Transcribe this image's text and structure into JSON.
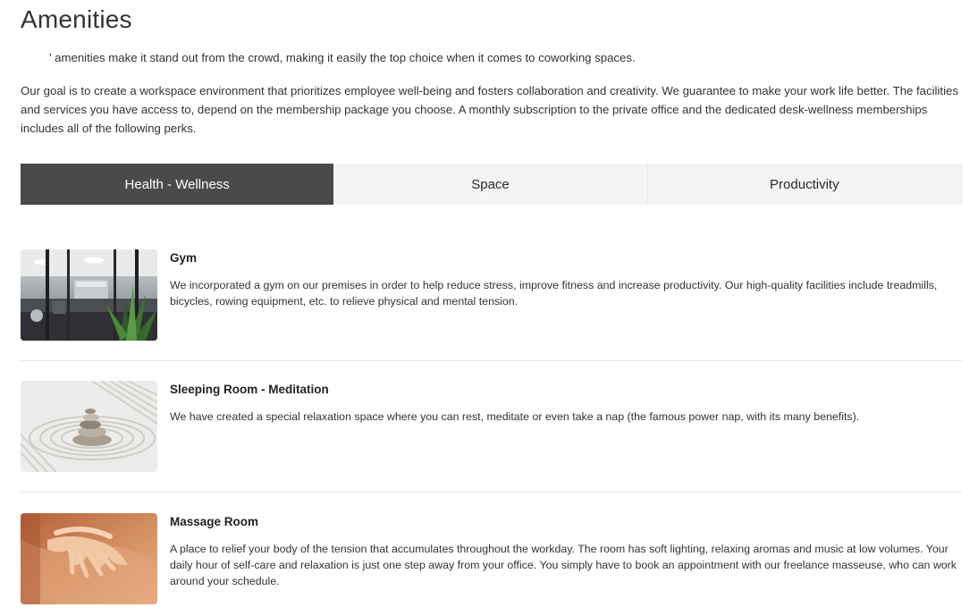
{
  "page": {
    "title": "Amenities",
    "intro_line": "' amenities make it stand out from the crowd, making it easily the top choice when it comes to coworking spaces.",
    "intro_paragraph": "Our goal is to create a workspace environment that prioritizes employee well-being and fosters collaboration and creativity. We guarantee to make your work life better. The facilities and services you have access to, depend on the membership package you choose. A monthly subscription to the private office and the dedicated desk-wellness memberships includes all of the following perks."
  },
  "tabs": [
    {
      "label": "Health - Wellness",
      "active": true
    },
    {
      "label": "Space",
      "active": false
    },
    {
      "label": "Productivity",
      "active": false
    }
  ],
  "amenities": [
    {
      "title": "Gym",
      "description": "We incorporated a gym on our premises in order to help reduce stress, improve fitness and increase productivity. Our high-quality facilities include treadmills, bicycles, rowing equipment, etc. to relieve physical and mental tension.",
      "image": "gym-photo"
    },
    {
      "title": "Sleeping Room - Meditation",
      "description": "We have created a special relaxation space where you can rest, meditate or even take a nap (the famous power nap, with its many benefits).",
      "image": "zen-stones-photo"
    },
    {
      "title": "Massage Room",
      "description": "A place to relief your body of the tension that accumulates throughout the workday. The room has soft lighting, relaxing aromas and music at low volumes. Your daily hour of self-care and relaxation is just one step away from your office. You simply have to book an appointment with our freelance masseuse, who can work around your schedule.",
      "image": "massage-photo"
    }
  ],
  "colors": {
    "active_tab_bg": "#4a4a4c",
    "inactive_tab_bg": "#f4f4f4",
    "divider": "#e6e6e6"
  }
}
